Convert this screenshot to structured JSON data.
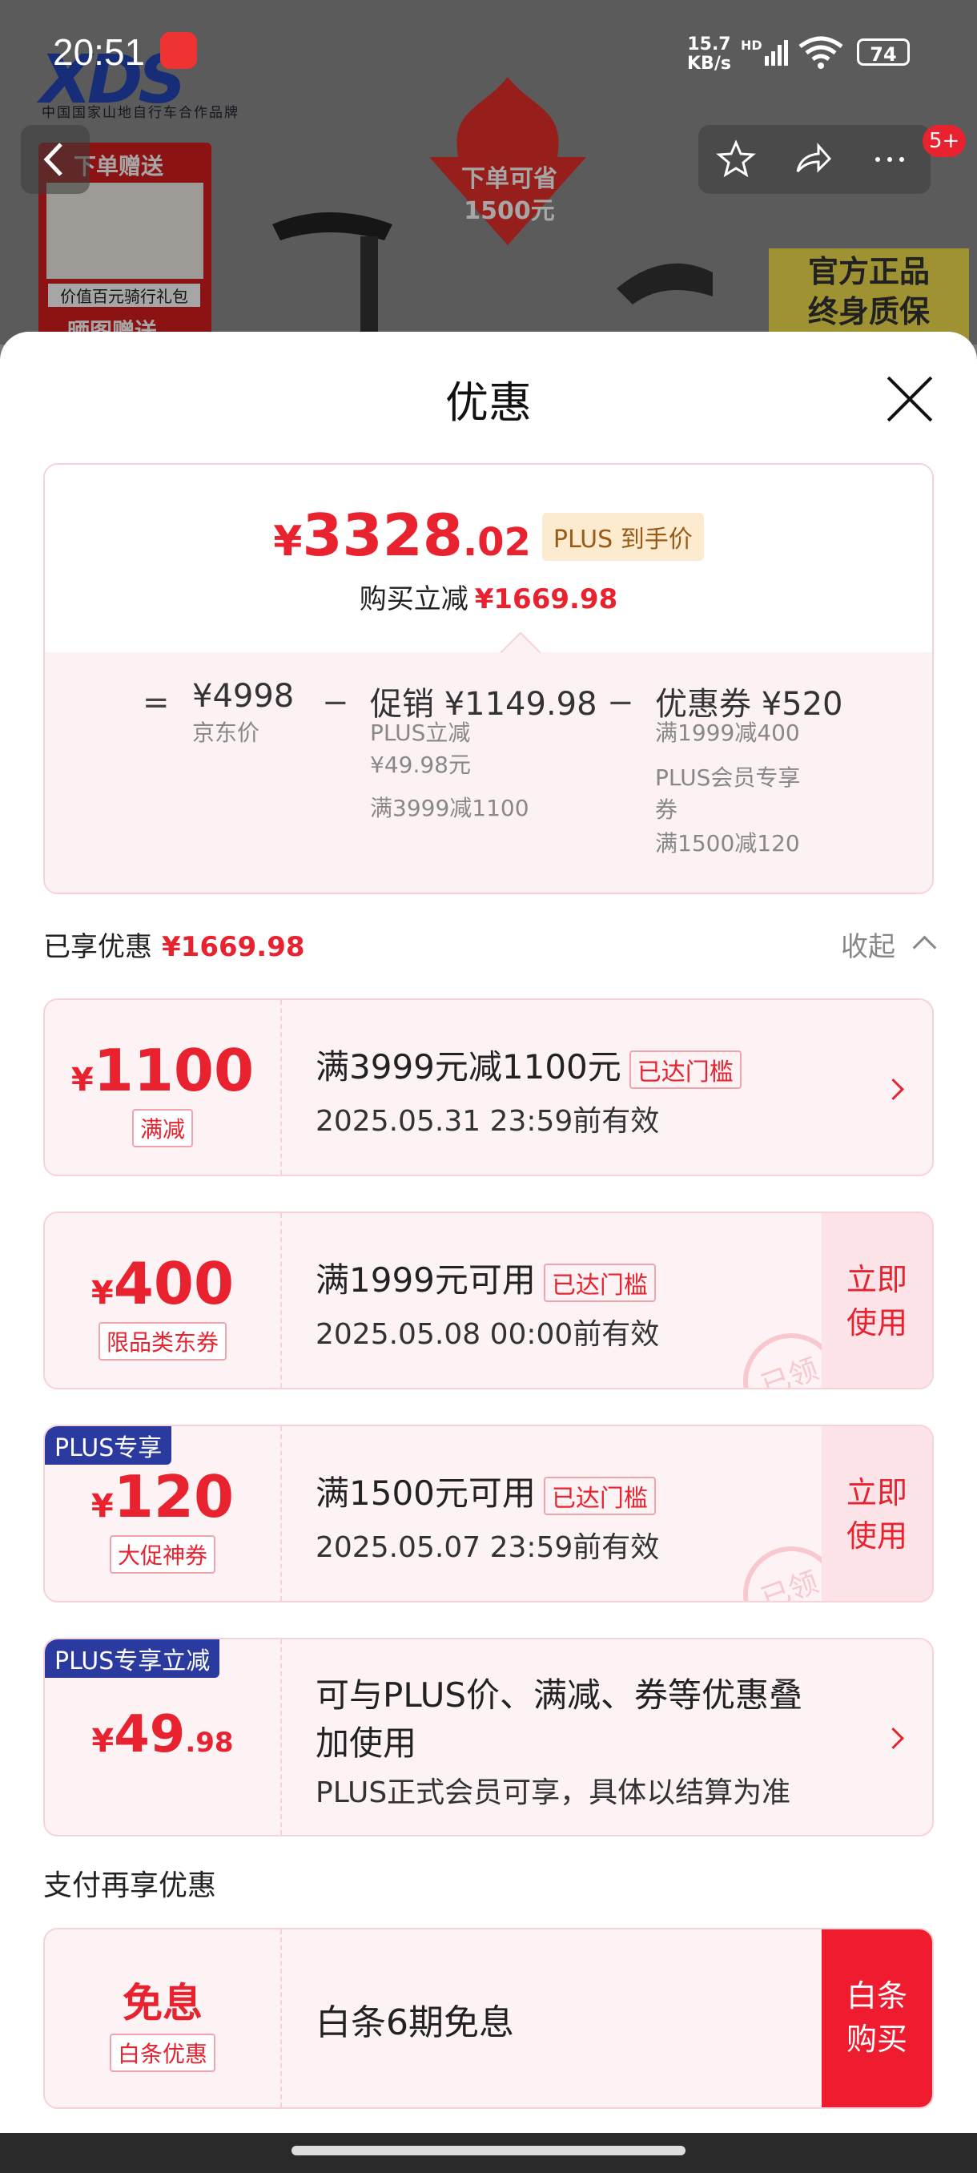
{
  "status": {
    "time": "20:51",
    "speed": "15.7",
    "speed_unit": "KB/s",
    "hd": "HD",
    "battery": "74"
  },
  "background": {
    "brand": "XDS",
    "brand_sub": "中国国家山地自行车合作品牌",
    "gift_title": "下单赠送",
    "gift_label": "价值百元骑行礼包",
    "share_gift": "晒图赠送",
    "save_title": "下单可省",
    "save_amount": "1500元",
    "quality": "官方正品\n终身质保",
    "badge": "5+"
  },
  "sheet": {
    "title": "优惠",
    "summary": {
      "currency": "¥",
      "price_int": "3328",
      "price_dec": ".02",
      "plus_tag": "PLUS 到手价",
      "reduce_label": "购买立减",
      "reduce_value": "¥1669.98",
      "eq": "=",
      "minus": "−",
      "col1_title": "¥4998",
      "col1_sub": "京东价",
      "col2_title": "促销 ¥1149.98",
      "col2_sub1": "PLUS立减",
      "col2_sub2": "¥49.98元",
      "col2_sub3": "满3999减1100",
      "col3_title": "优惠券 ¥520",
      "col3_sub1": "满1999减400",
      "col3_sub2": "PLUS会员专享",
      "col3_sub3": "券",
      "col3_sub4": "满1500减120"
    },
    "enjoyed": {
      "label": "已享优惠",
      "value": "¥1669.98",
      "collapse": "收起"
    },
    "coupons": [
      {
        "currency": "¥",
        "amount": "1100",
        "tag": "满减",
        "main": "满3999元减1100元",
        "reach": "已达门槛",
        "date": "2025.05.31 23:59前有效"
      },
      {
        "currency": "¥",
        "amount": "400",
        "tag": "限品类东券",
        "main": "满1999元可用",
        "reach": "已达门槛",
        "date": "2025.05.08 00:00前有效",
        "use": "立即\n使用",
        "stamp": "已领"
      },
      {
        "flag": "PLUS专享",
        "currency": "¥",
        "amount": "120",
        "tag": "大促神券",
        "main": "满1500元可用",
        "reach": "已达门槛",
        "date": "2025.05.07 23:59前有效",
        "use": "立即\n使用",
        "stamp": "已领"
      },
      {
        "flag": "PLUS专享立减",
        "currency": "¥",
        "amount": "49",
        "decimal": ".98",
        "main1": "可与PLUS价、满减、券等优惠叠",
        "main2": "加使用",
        "date": "PLUS正式会员可享，具体以结算为准"
      }
    ],
    "pay": {
      "title": "支付再享优惠",
      "free": "免息",
      "tag": "白条优惠",
      "main": "白条6期免息",
      "btn": "白条\n购买"
    }
  }
}
